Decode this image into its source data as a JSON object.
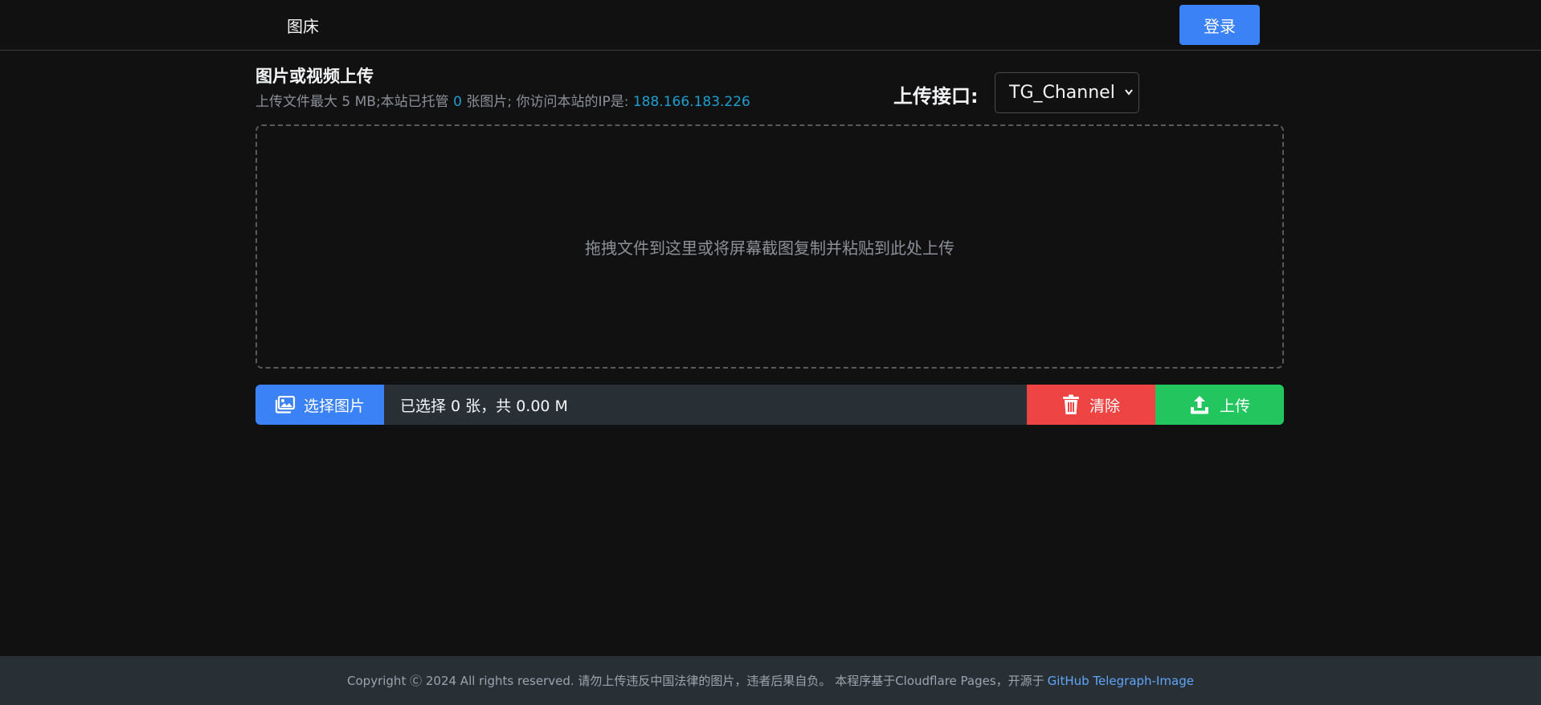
{
  "header": {
    "brand": "图床",
    "login_label": "登录"
  },
  "main": {
    "title": "图片或视频上传",
    "subtitle_prefix": "上传文件最大 5 MB;本站已托管 ",
    "hosted_count": "0",
    "subtitle_middle": " 张图片; 你访问本站的IP是: ",
    "ip": "188.166.183.226",
    "interface_label": "上传接口:",
    "interface_value": "TG_Channel",
    "dropzone_text": "拖拽文件到这里或将屏幕截图复制并粘贴到此处上传"
  },
  "actions": {
    "choose_label": "选择图片",
    "status_text": "已选择 0 张，共 0.00 M",
    "clear_label": "清除",
    "upload_label": "上传"
  },
  "footer": {
    "text": "Copyright Ⓒ 2024 All rights reserved. 请勿上传违反中国法律的图片，违者后果自负。 本程序基于Cloudflare Pages，开源于",
    "link": "GitHub Telegraph-Image"
  },
  "colors": {
    "background": "#111111",
    "primary": "#3b82f6",
    "danger": "#ef4444",
    "success": "#22c55e",
    "highlight": "#1f9fd0",
    "footer_bg": "#283036"
  },
  "icons": {
    "choose": "images-icon",
    "clear": "trash-icon",
    "upload": "upload-icon",
    "select_caret": "chevron-down-icon"
  }
}
